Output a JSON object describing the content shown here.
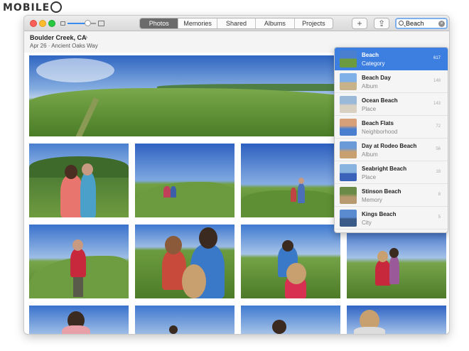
{
  "watermark": "MOBILE",
  "toolbar": {
    "tabs": [
      {
        "label": "Photos"
      },
      {
        "label": "Memories"
      },
      {
        "label": "Shared"
      },
      {
        "label": "Albums"
      },
      {
        "label": "Projects"
      }
    ],
    "active_tab": "Photos",
    "add_label": "+",
    "share_label": "⇪",
    "zoom_level_fraction": 0.7
  },
  "search": {
    "value": "Beach",
    "clear_label": "×"
  },
  "header": {
    "title": "Boulder Creek, CA",
    "chevron": "›",
    "subtitle": "Apr 26  ·  Ancient Oaks Way"
  },
  "results": [
    {
      "name": "Beach",
      "type": "Category",
      "count": "617"
    },
    {
      "name": "Beach Day",
      "type": "Album",
      "count": "148"
    },
    {
      "name": "Ocean Beach",
      "type": "Place",
      "count": "143"
    },
    {
      "name": "Beach Flats",
      "type": "Neighborhood",
      "count": "72"
    },
    {
      "name": "Day at Rodeo Beach",
      "type": "Album",
      "count": "56"
    },
    {
      "name": "Seabright Beach",
      "type": "Place",
      "count": "18"
    },
    {
      "name": "Stinson Beach",
      "type": "Memory",
      "count": "8"
    },
    {
      "name": "Kings Beach",
      "type": "City",
      "count": "5"
    }
  ],
  "colors": {
    "accent": "#3d7fe0",
    "close": "#fc5f57",
    "minimize": "#fdbc2e",
    "maximize": "#28c840"
  }
}
